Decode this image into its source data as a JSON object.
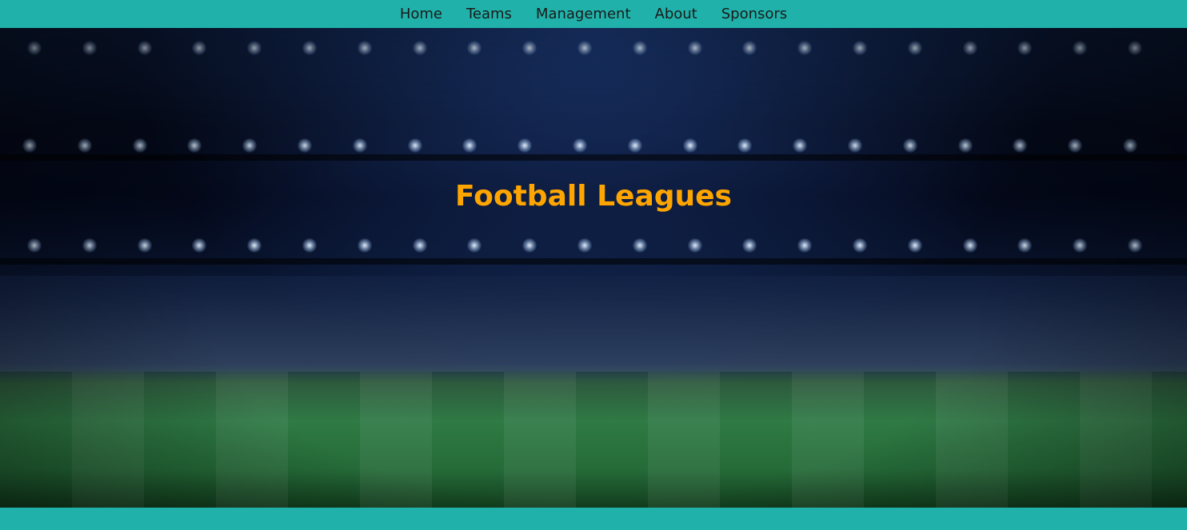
{
  "nav": {
    "items": [
      {
        "label": "Home"
      },
      {
        "label": "Teams"
      },
      {
        "label": "Management"
      },
      {
        "label": "About"
      },
      {
        "label": "Sponsors"
      }
    ]
  },
  "hero": {
    "title": "Football Leagues",
    "background": "stadium-background-image"
  },
  "colors": {
    "nav_background": "#20b2aa",
    "footer_background": "#20b2aa",
    "title_color": "#ffa500",
    "nav_text": "#1a1a1a"
  }
}
